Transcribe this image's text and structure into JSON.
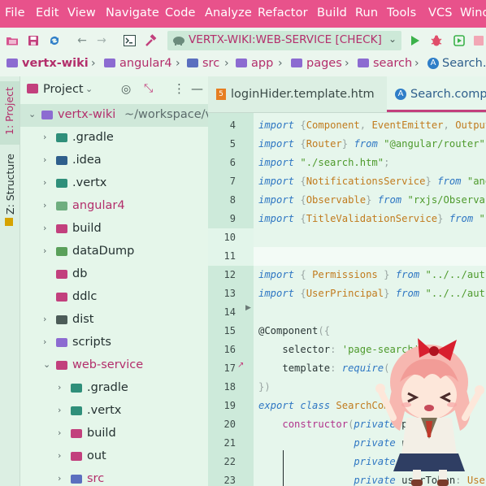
{
  "colors": {
    "menubar": "#e8528b",
    "accent": "#b32e6b",
    "panel": "#e5f6ea",
    "selection": "#cfe8d9"
  },
  "menu": [
    "File",
    "Edit",
    "View",
    "Navigate",
    "Code",
    "Analyze",
    "Refactor",
    "Build",
    "Run",
    "Tools",
    "VCS",
    "Wind"
  ],
  "toolbar": {
    "icons": [
      "open-folder-icon",
      "save-icon",
      "sync-icon",
      "back-arrow-icon",
      "forward-arrow-icon",
      "terminal-icon",
      "build-hammer-icon"
    ],
    "run_config": "VERTX-WIKI:WEB-SERVICE [CHECK]",
    "run_icons": [
      "run-icon",
      "debug-icon",
      "stop-icon"
    ]
  },
  "breadcrumb": [
    "vertx-wiki",
    "angular4",
    "src",
    "app",
    "pages",
    "search",
    "Search.co"
  ],
  "left_strip": {
    "project": "1: Project",
    "structure": "Z: Structure"
  },
  "project_panel": {
    "title": "Project",
    "tree": [
      {
        "label": "vertx-wiki",
        "extra": "~/workspace/ver",
        "depth": 0,
        "expanded": true,
        "accent": true
      },
      {
        "label": ".gradle",
        "depth": 1,
        "accent": false
      },
      {
        "label": ".idea",
        "depth": 1,
        "accent": false
      },
      {
        "label": ".vertx",
        "depth": 1,
        "accent": false
      },
      {
        "label": "angular4",
        "depth": 1,
        "accent": true
      },
      {
        "label": "build",
        "depth": 1,
        "accent": false
      },
      {
        "label": "dataDump",
        "depth": 1,
        "accent": false
      },
      {
        "label": "db",
        "depth": 1,
        "accent": false
      },
      {
        "label": "ddlc",
        "depth": 1,
        "accent": false
      },
      {
        "label": "dist",
        "depth": 1,
        "accent": false
      },
      {
        "label": "scripts",
        "depth": 1,
        "accent": false
      },
      {
        "label": "web-service",
        "depth": 1,
        "expanded": true,
        "accent": true
      },
      {
        "label": ".gradle",
        "depth": 2,
        "accent": false
      },
      {
        "label": ".vertx",
        "depth": 2,
        "accent": false
      },
      {
        "label": "build",
        "depth": 2,
        "accent": false
      },
      {
        "label": "out",
        "depth": 2,
        "accent": false
      },
      {
        "label": "src",
        "depth": 2,
        "accent": true
      }
    ]
  },
  "editor": {
    "tabs": [
      {
        "label": "loginHider.template.htm",
        "active": false
      },
      {
        "label": "Search.compo",
        "active": true
      }
    ],
    "lines": [
      {
        "n": "4",
        "code": "import {Component, EventEmitter, Output}"
      },
      {
        "n": "5",
        "code": "import {Router} from \"@angular/router\";"
      },
      {
        "n": "6",
        "code": "import \"./search.htm\";"
      },
      {
        "n": "7",
        "code": "import {NotificationsService} from \"angu"
      },
      {
        "n": "8",
        "code": "import {Observable} from \"rxjs/Observabl"
      },
      {
        "n": "9",
        "code": "import {TitleValidationService} from \".."
      },
      {
        "n": "10",
        "code": ""
      },
      {
        "n": "11",
        "code": ""
      },
      {
        "n": "12",
        "code": "import { Permissions } from \"../../auth/"
      },
      {
        "n": "13",
        "code": "import {UserPrincipal} from \"../../auth/"
      },
      {
        "n": "14",
        "code": ""
      },
      {
        "n": "15",
        "code": "@Component({"
      },
      {
        "n": "16",
        "code": "    selector: 'page-search',"
      },
      {
        "n": "17",
        "code": "    template: require( i"
      },
      {
        "n": "18",
        "code": "})"
      },
      {
        "n": "19",
        "code": "export class SearchCompo"
      },
      {
        "n": "20",
        "code": "    constructor(private pa"
      },
      {
        "n": "21",
        "code": "                private not"
      },
      {
        "n": "22",
        "code": "                private actu"
      },
      {
        "n": "23",
        "code": "                private userToken: UserP"
      }
    ]
  }
}
